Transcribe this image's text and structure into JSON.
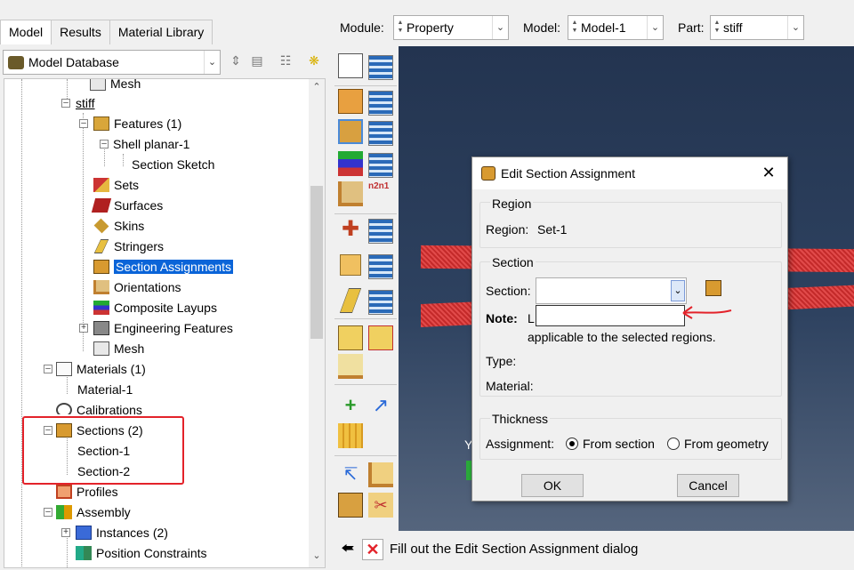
{
  "left": {
    "tabs": [
      {
        "label": "Model"
      },
      {
        "label": "Results"
      },
      {
        "label": "Material Library"
      }
    ],
    "db_combo": {
      "value": "Model Database"
    },
    "tree": [
      {
        "label": "Mesh"
      },
      {
        "label": "stiff"
      },
      {
        "label": "Features (1)"
      },
      {
        "label": "Shell planar-1"
      },
      {
        "label": "Section Sketch"
      },
      {
        "label": "Sets"
      },
      {
        "label": "Surfaces"
      },
      {
        "label": "Skins"
      },
      {
        "label": "Stringers"
      },
      {
        "label": "Section Assignments"
      },
      {
        "label": "Orientations"
      },
      {
        "label": "Composite Layups"
      },
      {
        "label": "Engineering Features"
      },
      {
        "label": "Mesh"
      },
      {
        "label": "Materials (1)"
      },
      {
        "label": "Material-1"
      },
      {
        "label": "Calibrations"
      },
      {
        "label": "Sections (2)"
      },
      {
        "label": "Section-1"
      },
      {
        "label": "Section-2"
      },
      {
        "label": "Profiles"
      },
      {
        "label": "Assembly"
      },
      {
        "label": "Instances (2)"
      },
      {
        "label": "Position Constraints"
      }
    ]
  },
  "topbar": {
    "module_label": "Module:",
    "module_value": "Property",
    "model_label": "Model:",
    "model_value": "Model-1",
    "part_label": "Part:",
    "part_value": "stiff"
  },
  "dialog": {
    "title": "Edit Section Assignment",
    "region_group": "Region",
    "region_label": "Region:",
    "region_value": "Set-1",
    "section_group": "Section",
    "section_label": "Section:",
    "section_value": "",
    "note_label": "Note:",
    "note_prefix": "L",
    "note_value": "",
    "note_tail": "applicable to the selected regions.",
    "type_label": "Type:",
    "material_label": "Material:",
    "thickness_group": "Thickness",
    "assignment_label": "Assignment:",
    "from_section": "From section",
    "from_geometry": "From geometry",
    "ok": "OK",
    "cancel": "Cancel"
  },
  "viewport": {
    "axis_y": "Y"
  },
  "prompt": {
    "message": "Fill out the Edit Section Assignment dialog"
  },
  "colors": {
    "annotation_red": "#e3222a",
    "selection_blue": "#0a64d8",
    "plate_red": "#d43a3a",
    "viewport_top": "#233450"
  },
  "icons": [
    "database-icon",
    "tree-icon",
    "features-icon",
    "sets-icon",
    "surfaces-icon",
    "skins-icon",
    "stringers-icon",
    "section-assignment-icon",
    "orientations-icon",
    "composite-layups-icon",
    "engineering-features-icon",
    "mesh-icon",
    "materials-icon",
    "calibrations-icon",
    "sections-icon",
    "profiles-icon",
    "assembly-icon",
    "instances-icon",
    "position-constraints-icon",
    "back-arrow-icon",
    "cancel-x-icon",
    "close-icon"
  ]
}
